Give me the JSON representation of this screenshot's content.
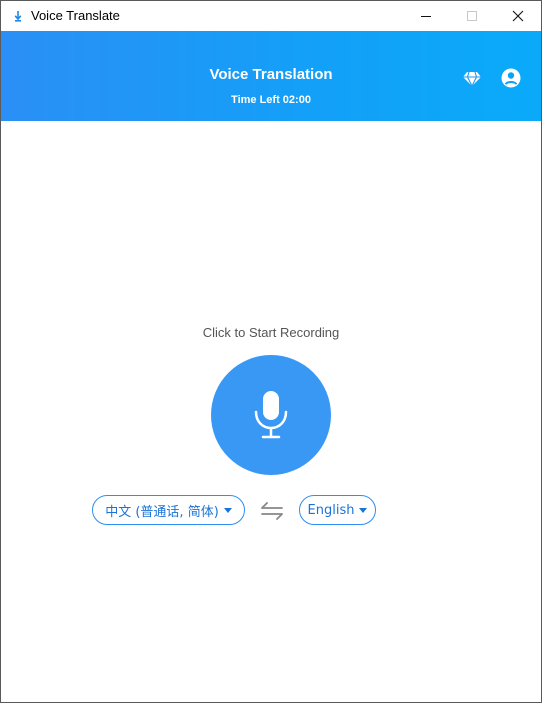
{
  "window": {
    "title": "Voice Translate"
  },
  "header": {
    "title": "Voice Translation",
    "time_left": "Time Left 02:00",
    "icons": [
      "diamond-icon",
      "account-icon"
    ]
  },
  "main": {
    "prompt": "Click to Start Recording",
    "mic_icon": "microphone-icon"
  },
  "languages": {
    "source": "中文 (普通话, 简体)",
    "target": "English",
    "swap_icon": "swap-arrows-icon"
  },
  "colors": {
    "accent": "#2e8ff2",
    "header_start": "#2b8ff6",
    "header_end": "#0aaaf9",
    "mic": "#3a98f5"
  }
}
